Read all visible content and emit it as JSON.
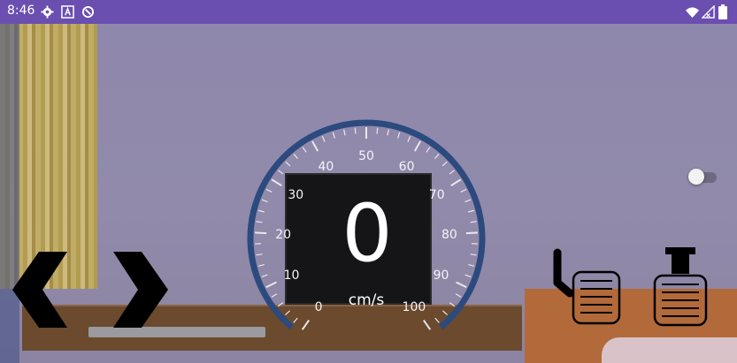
{
  "status_bar": {
    "time": "8:46",
    "left_icons": [
      "settings-icon",
      "font-icon",
      "sync-icon"
    ],
    "right_icons": [
      "wifi-icon",
      "signal-icon",
      "battery-icon"
    ],
    "background": "#6a4fb0"
  },
  "speedometer": {
    "value": "0",
    "unit": "cm/s",
    "tick_labels": [
      "0",
      "10",
      "20",
      "30",
      "40",
      "50",
      "60",
      "70",
      "80",
      "90",
      "100"
    ],
    "min": 0,
    "max": 100,
    "ring_color": "#2c4a7e"
  },
  "controls": {
    "steer_left_icon": "chevron-left-icon",
    "steer_right_icon": "chevron-right-icon",
    "brake_icon": "brake-pedal-icon",
    "accelerator_icon": "accelerator-pedal-icon",
    "toggle_state": "off"
  }
}
